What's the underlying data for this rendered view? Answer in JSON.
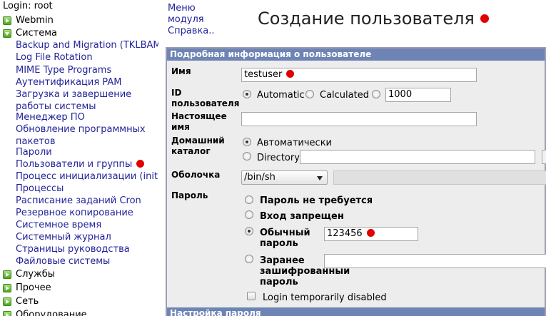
{
  "login": "Login: root",
  "sidebar": {
    "categories": {
      "webmin": "Webmin",
      "system": "Система",
      "services": "Службы",
      "other": "Прочее",
      "net": "Сеть",
      "hardware": "Оборудование"
    },
    "modules": [
      "Backup and Migration (TKLBAM)",
      "Log File Rotation",
      "MIME Type Programs",
      "Аутентификация PAM",
      "Загрузка и завершение работы системы",
      "Менеджер ПО",
      "Обновление программных пакетов",
      "Пароли",
      "Пользователи и группы",
      "Процесс инициализации (init)",
      "Процессы",
      "Расписание заданий Cron",
      "Резервное копирование",
      "Системное время",
      "Системный журнал",
      "Страницы руководства",
      "Файловые системы"
    ]
  },
  "help": {
    "line1": "Меню",
    "line2": "модуля",
    "line3": "Справка.."
  },
  "page_title": "Создание пользователя",
  "form": {
    "section_title": "Подробная информация о пользователе",
    "username_label": "Имя",
    "username_value": "testuser",
    "uid_label": "ID пользователя",
    "uid_automatic": "Automatic",
    "uid_calculated": "Calculated",
    "uid_value": "1000",
    "realname_label": "Настоящее имя",
    "realname_value": "",
    "home_label": "Домашний каталог",
    "home_auto": "Автоматически",
    "home_directory": "Directory",
    "home_value": "",
    "shell_label": "Оболочка",
    "shell_value": "/bin/sh",
    "password_label": "Пароль",
    "pw_none": "Пароль не требуется",
    "pw_locked": "Вход запрещен",
    "pw_normal": "Обычный пароль",
    "pw_normal_value": "123456",
    "pw_encrypted": "Заранее зашифрованный пароль",
    "pw_encrypted_value": "",
    "login_disabled": "Login temporarily disabled",
    "section2_title": "Настройка пароля"
  },
  "colors": {
    "header_blue": "#6d84b4",
    "link_blue": "#22239a",
    "marker_red": "#e00000"
  }
}
